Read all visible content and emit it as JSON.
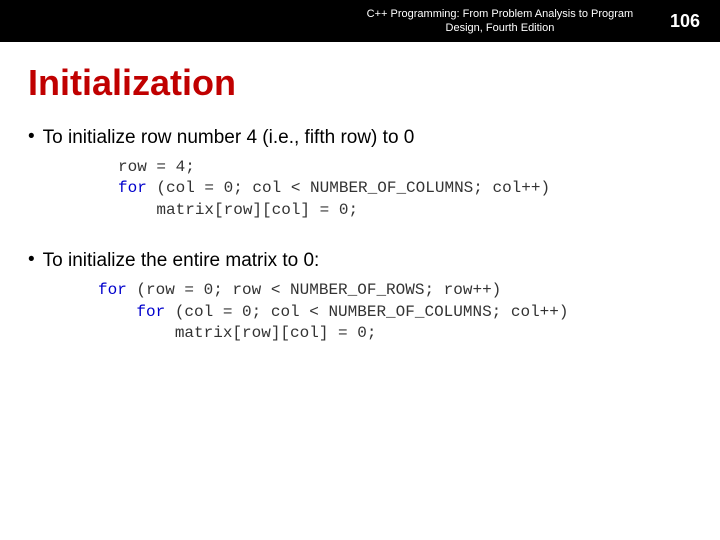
{
  "header": {
    "book_title": "C++ Programming: From Problem Analysis to Program Design, Fourth Edition",
    "page_number": "106"
  },
  "slide": {
    "title": "Initialization",
    "bullets": [
      {
        "text": "To initialize row number 4 (i.e., fifth row) to 0"
      },
      {
        "text": "To initialize the entire matrix to 0:"
      }
    ],
    "code1_line1": "row = 4;",
    "code1_line2_kw": "for",
    "code1_line2_rest": " (col = 0; col < NUMBER_OF_COLUMNS; col++)",
    "code1_line3": "    matrix[row][col] = 0;",
    "code2_line1_kw": "for",
    "code2_line1_rest": " (row = 0; row < NUMBER_OF_ROWS; row++)",
    "code2_line2_kw": "for",
    "code2_line2_pre": "    ",
    "code2_line2_rest": " (col = 0; col < NUMBER_OF_COLUMNS; col++)",
    "code2_line3": "        matrix[row][col] = 0;"
  }
}
